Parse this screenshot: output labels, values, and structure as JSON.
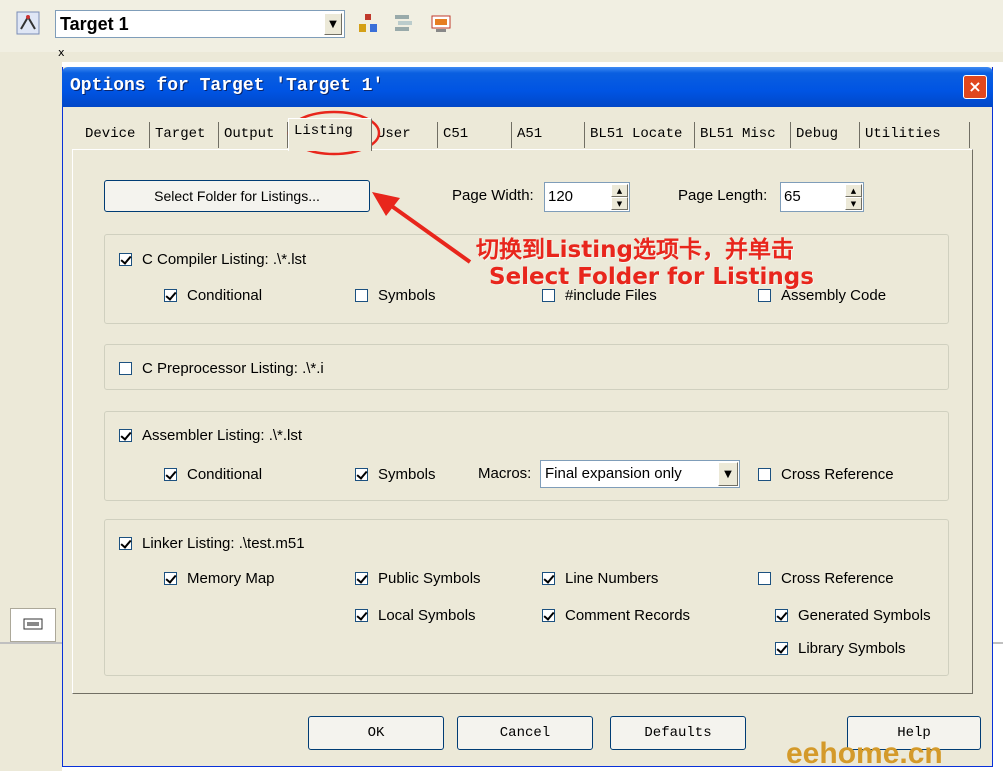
{
  "ide": {
    "target_select": "Target 1",
    "panel_tab_close": "x"
  },
  "dialog": {
    "title": "Options for Target 'Target 1'",
    "close": "×"
  },
  "tabs": [
    "Device",
    "Target",
    "Output",
    "Listing",
    "User",
    "C51",
    "A51",
    "BL51 Locate",
    "BL51 Misc",
    "Debug",
    "Utilities"
  ],
  "active_tab": "Listing",
  "listing": {
    "select_folder_button": "Select Folder for Listings...",
    "page_width_label": "Page Width:",
    "page_width_value": "120",
    "page_length_label": "Page Length:",
    "page_length_value": "65",
    "c_compiler": {
      "label": "C Compiler Listing:  .\\*.lst",
      "checked": true,
      "conditional": {
        "label": "Conditional",
        "checked": true
      },
      "symbols": {
        "label": "Symbols",
        "checked": false
      },
      "include_files": {
        "label": "#include Files",
        "checked": false
      },
      "assembly_code": {
        "label": "Assembly Code",
        "checked": false
      }
    },
    "c_preprocessor": {
      "label": "C Preprocessor Listing:  .\\*.i",
      "checked": false
    },
    "assembler": {
      "label": "Assembler Listing:  .\\*.lst",
      "checked": true,
      "conditional": {
        "label": "Conditional",
        "checked": true
      },
      "symbols": {
        "label": "Symbols",
        "checked": true
      },
      "macros_label": "Macros:",
      "macros_value": "Final expansion only",
      "cross_reference": {
        "label": "Cross Reference",
        "checked": false
      }
    },
    "linker": {
      "label": "Linker Listing:  .\\test.m51",
      "checked": true,
      "memory_map": {
        "label": "Memory Map",
        "checked": true
      },
      "public_symbols": {
        "label": "Public Symbols",
        "checked": true
      },
      "line_numbers": {
        "label": "Line Numbers",
        "checked": true
      },
      "cross_reference": {
        "label": "Cross Reference",
        "checked": false
      },
      "local_symbols": {
        "label": "Local Symbols",
        "checked": true
      },
      "comment_records": {
        "label": "Comment Records",
        "checked": true
      },
      "generated_symbols": {
        "label": "Generated Symbols",
        "checked": true
      },
      "library_symbols": {
        "label": "Library Symbols",
        "checked": true
      }
    }
  },
  "footer": {
    "ok": "OK",
    "cancel": "Cancel",
    "defaults": "Defaults",
    "help": "Help"
  },
  "annotation": {
    "line1": "切换到Listing选项卡，并单击",
    "line2": "Select  Folder for Listings",
    "color": "#e8261c"
  },
  "watermark": "eehome.cn"
}
